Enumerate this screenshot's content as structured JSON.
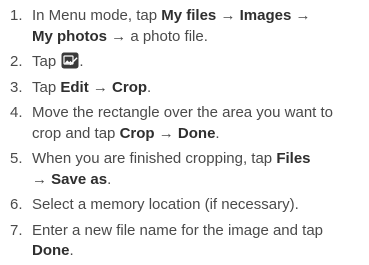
{
  "steps": [
    {
      "number": "1.",
      "parts": [
        "In Menu mode, tap ",
        "My files",
        " → ",
        "Images",
        " → ",
        "My photos",
        " → a photo file."
      ]
    },
    {
      "number": "2.",
      "text_before": "Tap ",
      "icon": "edit-image-icon",
      "text_after": "."
    },
    {
      "number": "3.",
      "parts": [
        "Tap ",
        "Edit",
        " → ",
        "Crop",
        "."
      ]
    },
    {
      "number": "4.",
      "parts": [
        "Move the rectangle over the area you want to crop and tap ",
        "Crop",
        " → ",
        "Done",
        "."
      ]
    },
    {
      "number": "5.",
      "parts": [
        "When you are finished cropping, tap ",
        "Files",
        " → ",
        "Save as",
        "."
      ]
    },
    {
      "number": "6.",
      "text": "Select a memory location (if necessary)."
    },
    {
      "number": "7.",
      "parts": [
        "Enter a new file name for the image and tap ",
        "Done",
        "."
      ]
    }
  ],
  "colors": {
    "text": "#4a4a4a",
    "ui_term": "#2f2f2f",
    "icon_bg": "#3a3a3a",
    "icon_fg": "#ffffff"
  }
}
